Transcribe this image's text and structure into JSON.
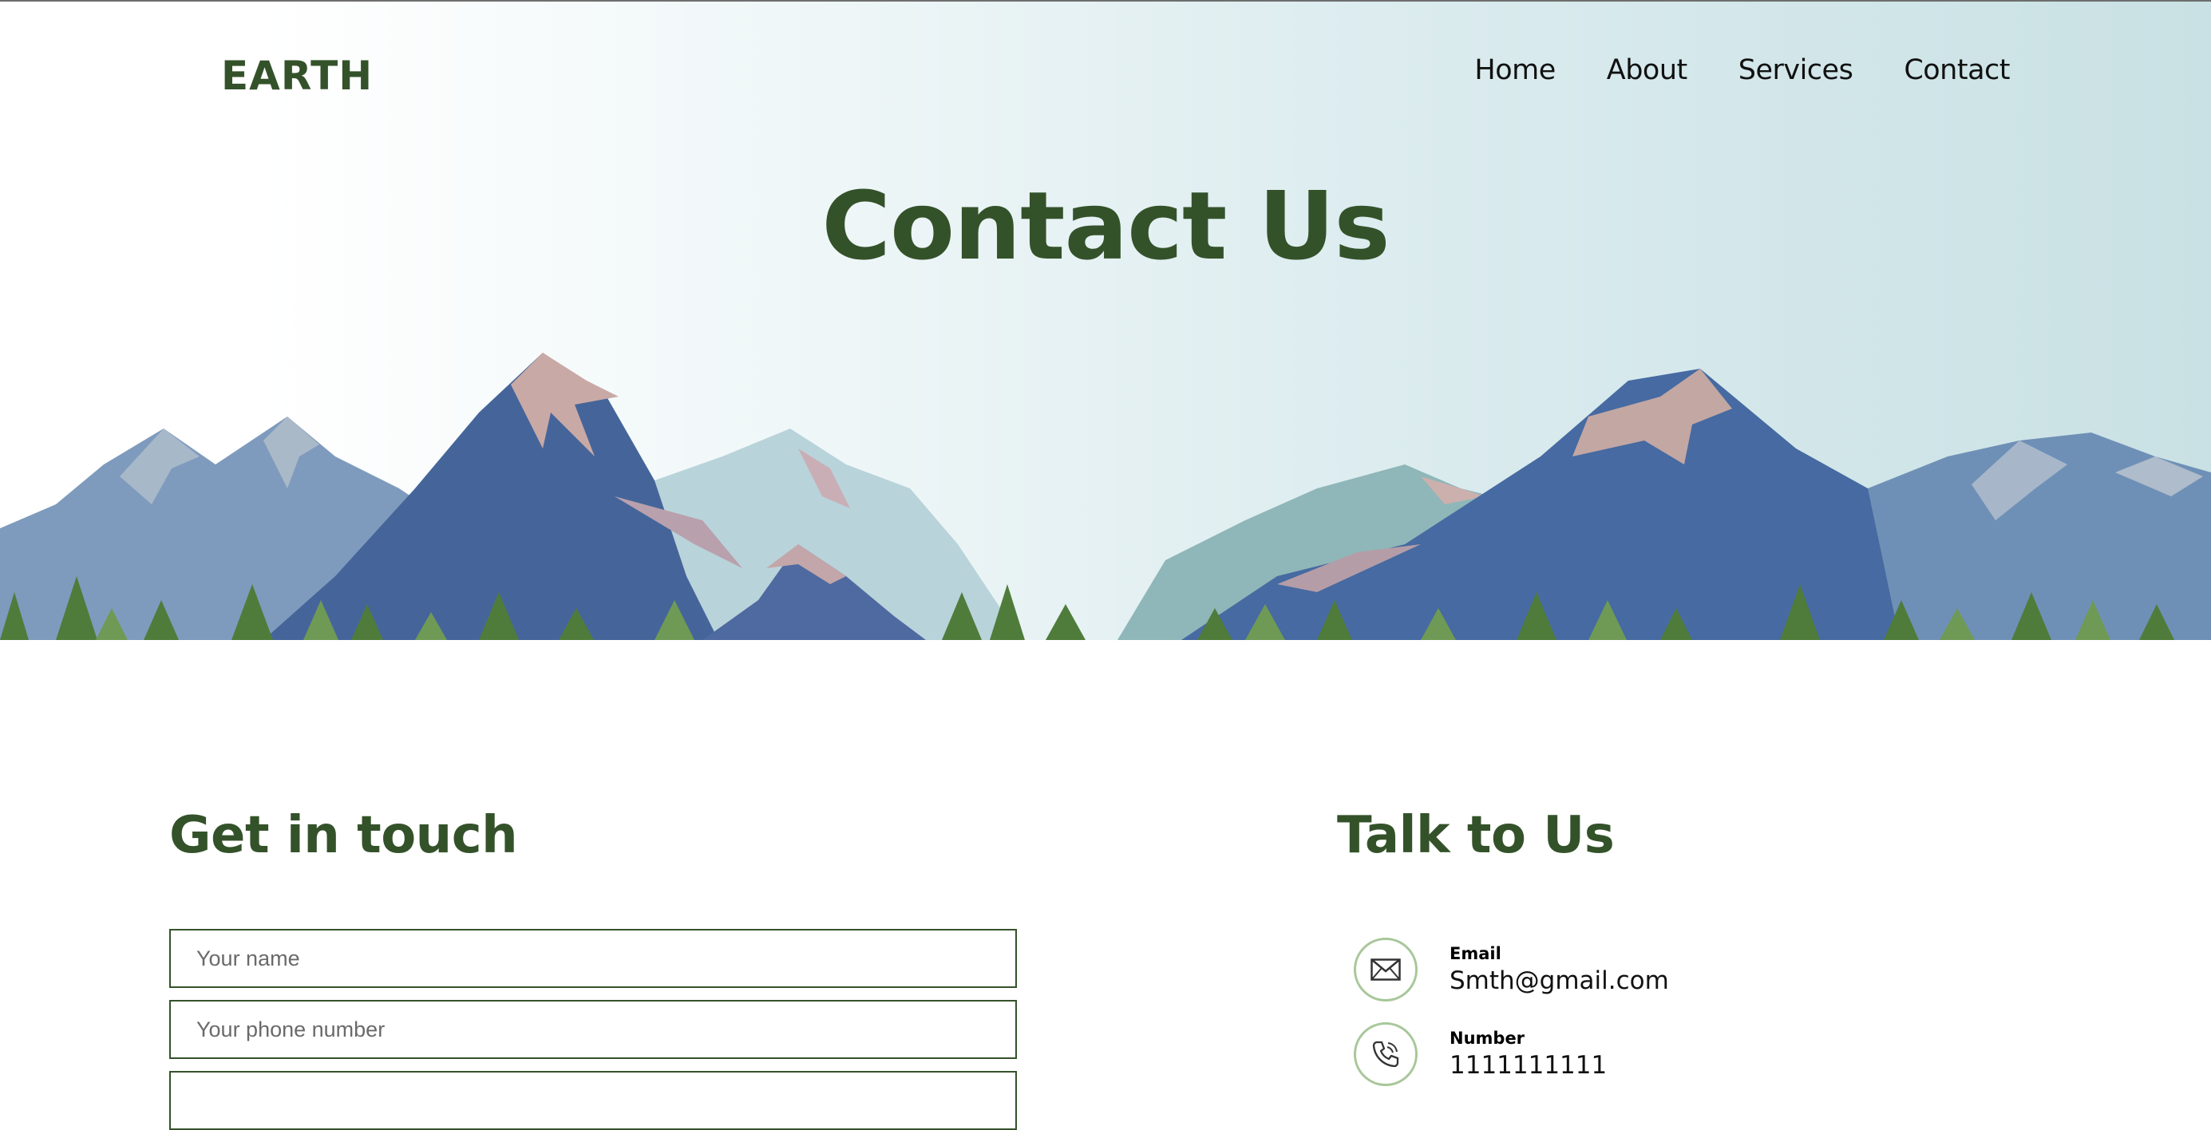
{
  "header": {
    "logo": "EARTH",
    "nav": [
      "Home",
      "About",
      "Services",
      "Contact"
    ]
  },
  "hero": {
    "title": "Contact Us"
  },
  "form": {
    "title": "Get in touch",
    "fields": [
      {
        "placeholder": "Your name",
        "value": ""
      },
      {
        "placeholder": "Your phone number",
        "value": ""
      },
      {
        "placeholder": "",
        "value": ""
      }
    ]
  },
  "talk": {
    "title": "Talk to Us",
    "items": [
      {
        "label": "Email",
        "value": "Smth@gmail.com",
        "icon": "envelope-icon"
      },
      {
        "label": "Number",
        "value": "1111111111",
        "icon": "phone-icon"
      }
    ]
  },
  "colors": {
    "brand_green": "#34522a",
    "icon_ring": "#a8c79a",
    "mountain_dark": "#45659a",
    "mountain_light": "#b9d3da"
  }
}
